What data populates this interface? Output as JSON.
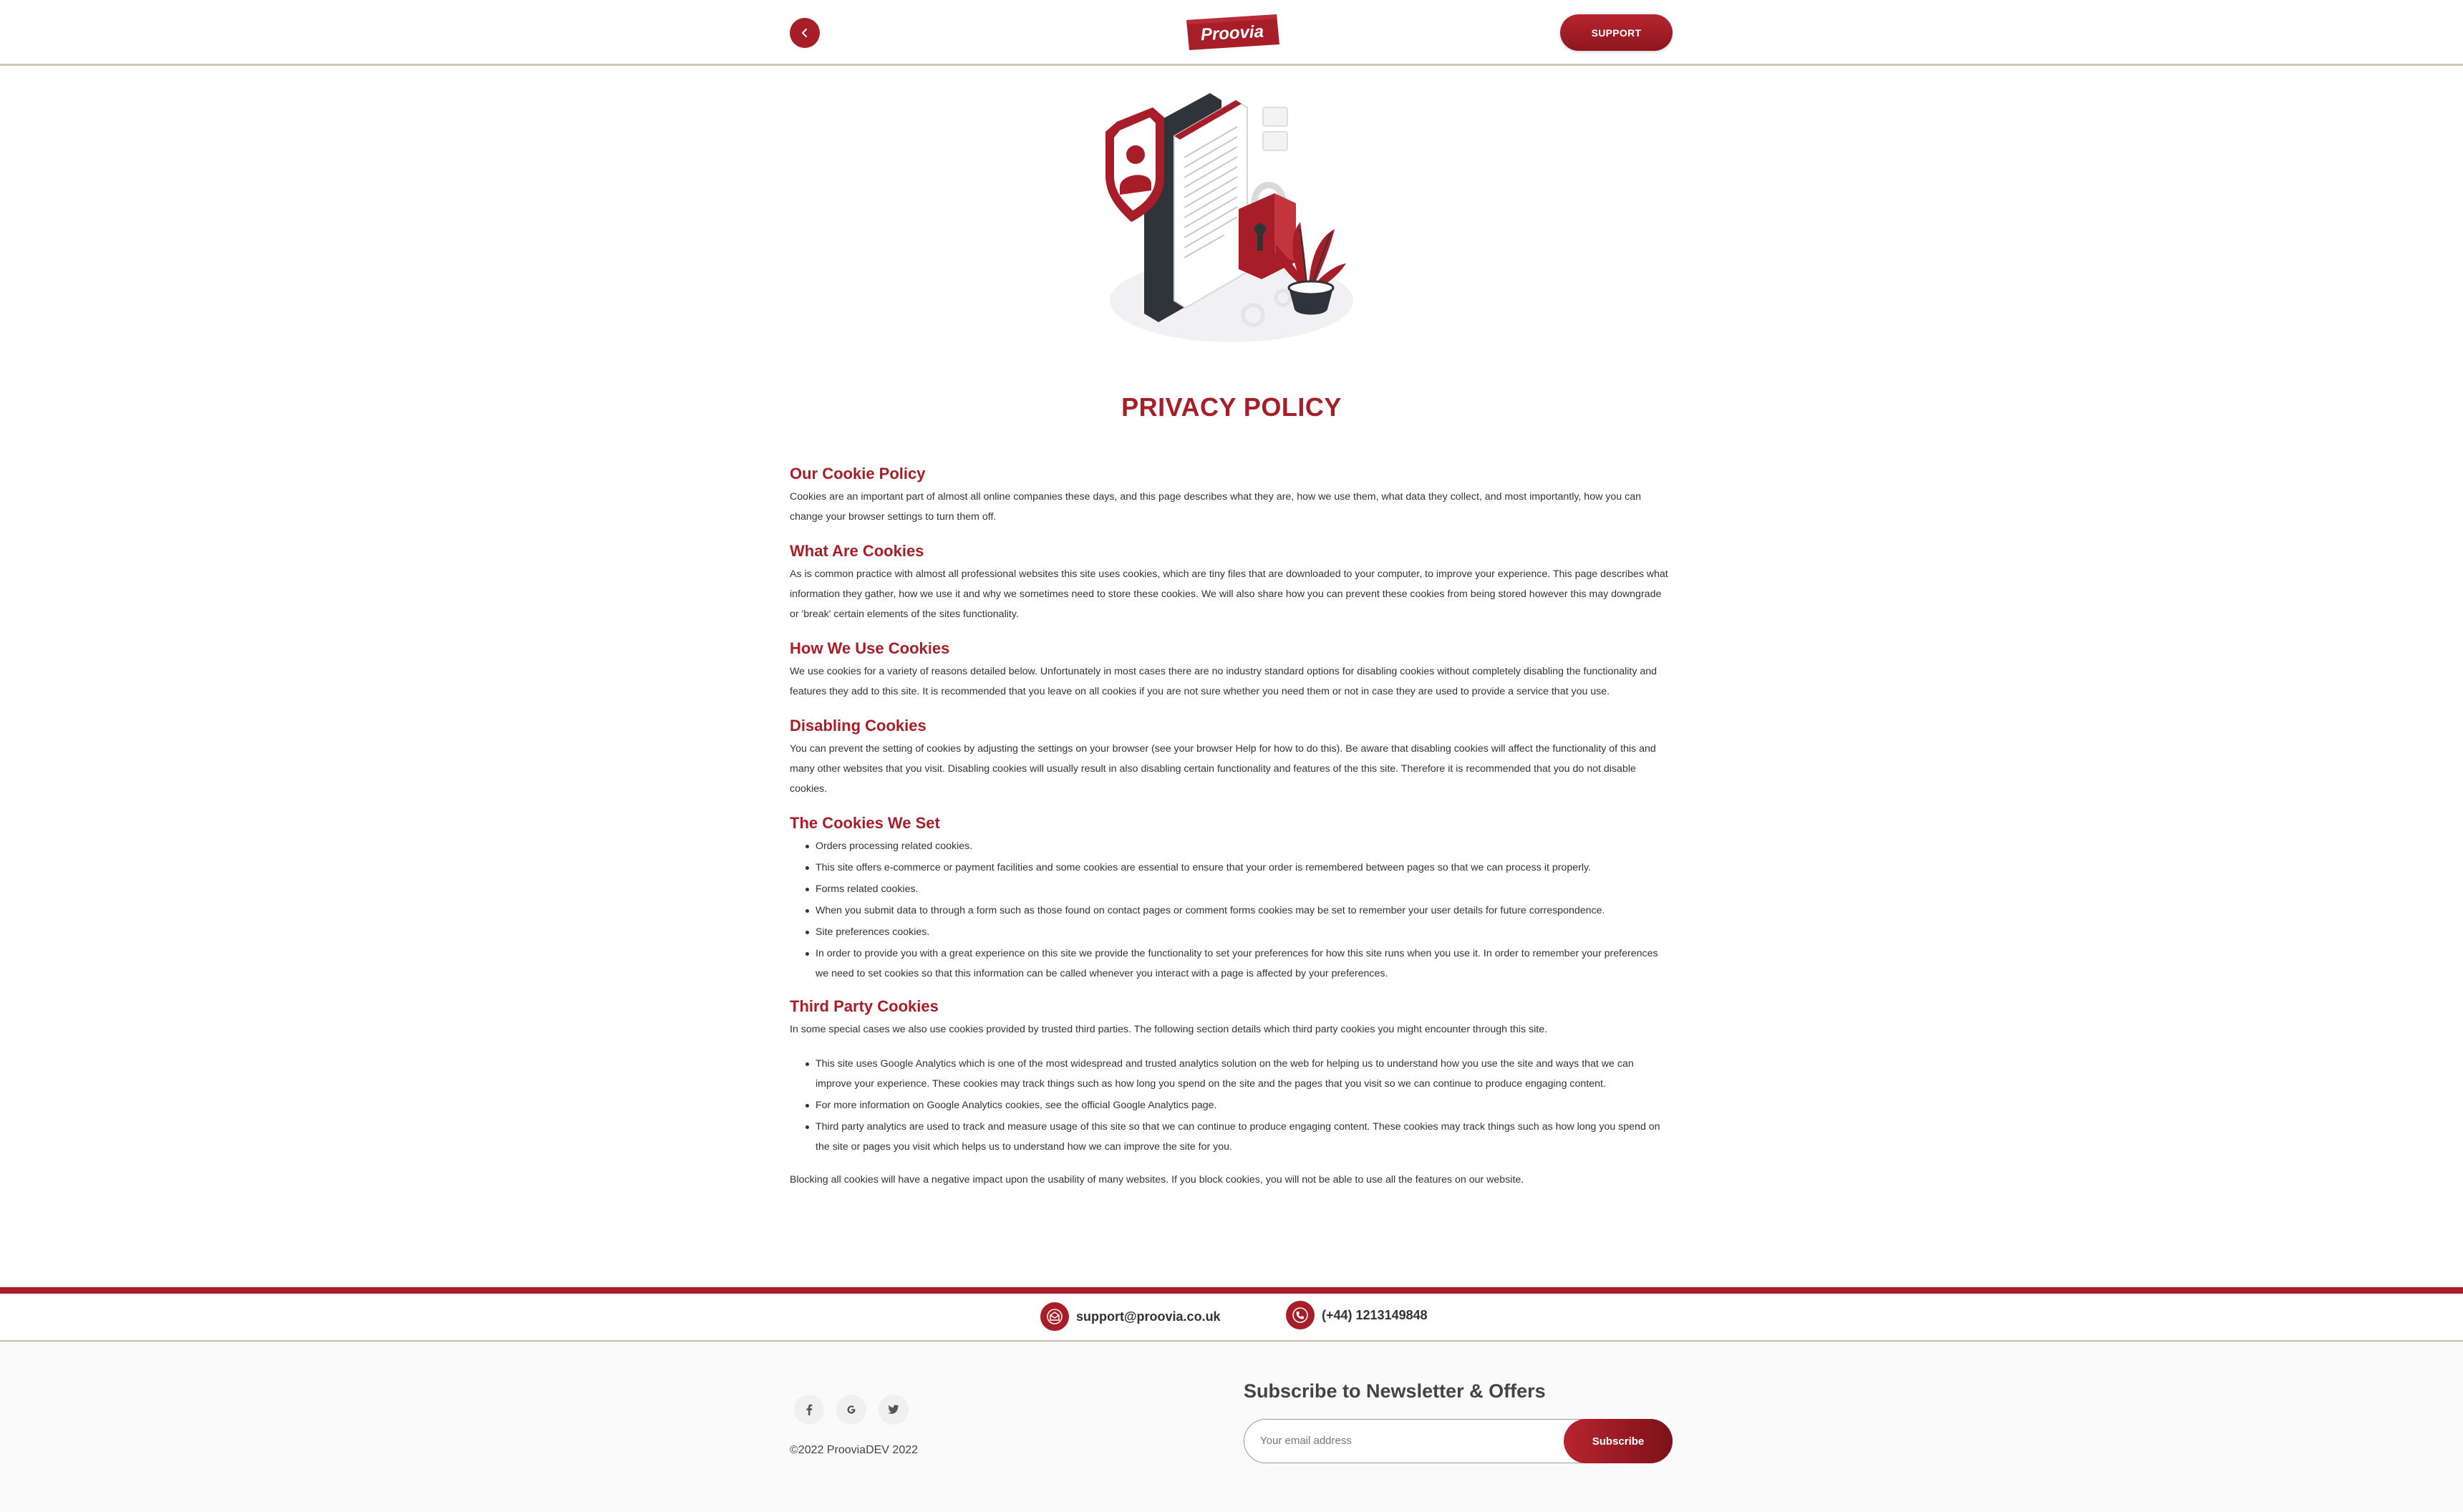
{
  "header": {
    "logo_text": "Proovia",
    "support_label": "SUPPORT"
  },
  "page": {
    "title": "PRIVACY POLICY"
  },
  "sections": {
    "cookie_policy": {
      "heading": "Our Cookie Policy",
      "body": "Cookies are an important part of almost all online companies these days, and this page describes what they are, how we use them, what data they collect, and most importantly, how you can change your browser settings to turn them off."
    },
    "what_are": {
      "heading": "What Are Cookies",
      "body": "As is common practice with almost all professional websites this site uses cookies, which are tiny files that are downloaded to your computer, to improve your experience. This page describes what information they gather, how we use it and why we sometimes need to store these cookies. We will also share how you can prevent these cookies from being stored however this may downgrade or 'break' certain elements of the sites functionality."
    },
    "how_we_use": {
      "heading": "How We Use Cookies",
      "body": "We use cookies for a variety of reasons detailed below. Unfortunately in most cases there are no industry standard options for disabling cookies without completely disabling the functionality and features they add to this site. It is recommended that you leave on all cookies if you are not sure whether you need them or not in case they are used to provide a service that you use."
    },
    "disabling": {
      "heading": "Disabling Cookies",
      "body": "You can prevent the setting of cookies by adjusting the settings on your browser (see your browser Help for how to do this). Be aware that disabling cookies will affect the functionality of this and many other websites that you visit. Disabling cookies will usually result in also disabling certain functionality and features of the this site. Therefore it is recommended that you do not disable cookies."
    },
    "cookies_set": {
      "heading": "The Cookies We Set",
      "items": [
        "Orders processing related cookies.",
        "This site offers e-commerce or payment facilities and some cookies are essential to ensure that your order is remembered between pages so that we can process it properly.",
        "Forms related cookies.",
        "When you submit data to through a form such as those found on contact pages or comment forms cookies may be set to remember your user details for future correspondence.",
        "Site preferences cookies.",
        "In order to provide you with a great experience on this site we provide the functionality to set your preferences for how this site runs when you use it. In order to remember your preferences we need to set cookies so that this information can be called whenever you interact with a page is affected by your preferences."
      ]
    },
    "third_party": {
      "heading": "Third Party Cookies",
      "intro": "In some special cases we also use cookies provided by trusted third parties. The following section details which third party cookies you might encounter through this site.",
      "items": [
        "This site uses Google Analytics which is one of the most widespread and trusted analytics solution on the web for helping us to understand how you use the site and ways that we can improve your experience. These cookies may track things such as how long you spend on the site and the pages that you visit so we can continue to produce engaging content.",
        "For more information on Google Analytics cookies, see the official Google Analytics page.",
        "Third party analytics are used to track and measure usage of this site so that we can continue to produce engaging content. These cookies may track things such as how long you spend on the site or pages you visit which helps us to understand how we can improve the site for you."
      ]
    },
    "closing": "Blocking all cookies will have a negative impact upon the usability of many websites. If you block cookies, you will not be able to use all the features on our website."
  },
  "contact": {
    "email": "support@proovia.co.uk",
    "phone": "(+44) 1213149848"
  },
  "footer": {
    "copyright": "©2022 ProoviaDEV 2022",
    "newsletter_title": "Subscribe to Newsletter & Offers",
    "email_placeholder": "Your email address",
    "subscribe_label": "Subscribe",
    "social": [
      "facebook-icon",
      "google-icon",
      "twitter-icon"
    ]
  },
  "colors": {
    "brand": "#a81e28",
    "header_border": "#d6c6b4"
  }
}
